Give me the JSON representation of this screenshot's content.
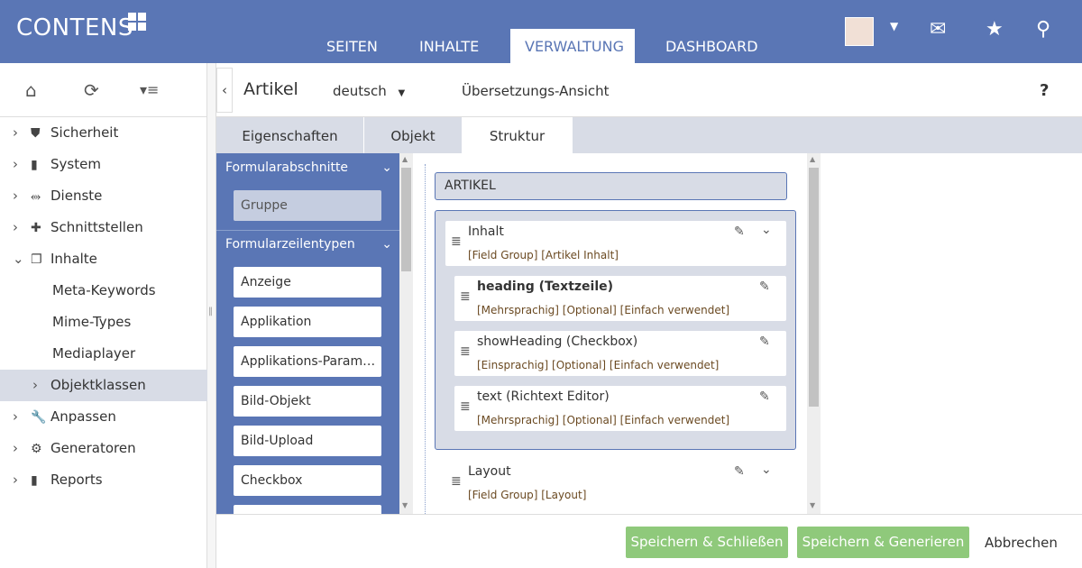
{
  "header": {
    "logo": "CONTENS",
    "nav": [
      "SEITEN",
      "INHALTE",
      "VERWALTUNG",
      "DASHBOARD"
    ],
    "active_nav": "VERWALTUNG",
    "brand_color": "#5a76b5"
  },
  "sidebar": {
    "items": [
      {
        "label": "Sicherheit",
        "icon": "shield-icon",
        "chev": "›"
      },
      {
        "label": "System",
        "icon": "server-icon",
        "chev": "›"
      },
      {
        "label": "Dienste",
        "icon": "services-icon",
        "chev": "›"
      },
      {
        "label": "Schnittstellen",
        "icon": "puzzle-icon",
        "chev": "›"
      },
      {
        "label": "Inhalte",
        "icon": "copy-icon",
        "chev": "⌄"
      },
      {
        "label": "Meta-Keywords"
      },
      {
        "label": "Mime-Types"
      },
      {
        "label": "Mediaplayer"
      },
      {
        "label": "Objektklassen",
        "chev": "›"
      },
      {
        "label": "Anpassen",
        "icon": "wrench-icon",
        "chev": "›"
      },
      {
        "label": "Generatoren",
        "icon": "gear-icon",
        "chev": "›"
      },
      {
        "label": "Reports",
        "icon": "chart-icon",
        "chev": "›"
      }
    ]
  },
  "toolbar": {
    "title": "Artikel",
    "language": "deutsch",
    "view": "Übersetzungs-Ansicht",
    "help": "?"
  },
  "tabs": [
    "Eigenschaften",
    "Objekt",
    "Struktur"
  ],
  "left_panel": {
    "section1": "Formularabschnitte",
    "section1_items": [
      "Gruppe"
    ],
    "section2": "Formularzeilentypen",
    "section2_items": [
      "Anzeige",
      "Applikation",
      "Applikations-Param…",
      "Bild-Objekt",
      "Bild-Upload",
      "Checkbox"
    ]
  },
  "structure": {
    "root": "ARTIKEL",
    "groups": [
      {
        "title": "Inhalt",
        "meta": "[Field Group] [Artikel Inhalt]",
        "children": [
          {
            "title": "heading (Textzeile)",
            "meta": "[Mehrsprachig] [Optional] [Einfach verwendet]"
          },
          {
            "title": "showHeading (Checkbox)",
            "meta": "[Einsprachig] [Optional] [Einfach verwendet]"
          },
          {
            "title": "text (Richtext Editor)",
            "meta": "[Mehrsprachig] [Optional] [Einfach verwendet]"
          }
        ]
      },
      {
        "title": "Layout",
        "meta": "[Field Group] [Layout]"
      }
    ]
  },
  "footer": {
    "save_close": "Speichern & Schließen",
    "save_generate": "Speichern & Generieren",
    "cancel": "Abbrechen"
  }
}
